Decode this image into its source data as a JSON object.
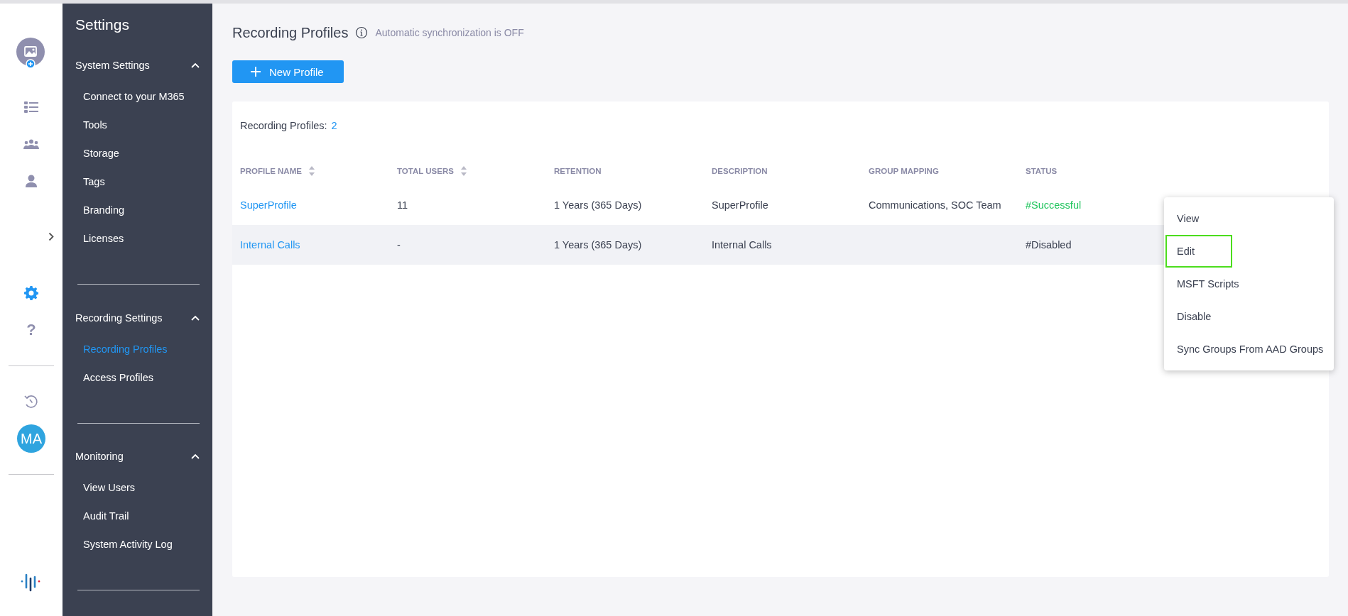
{
  "rail": {
    "top_items": [
      {
        "kind": "list",
        "selected": false
      },
      {
        "kind": "team",
        "selected": false
      },
      {
        "kind": "person",
        "selected": false
      }
    ],
    "mid_items": [
      {
        "kind": "settings",
        "selected": true
      },
      {
        "kind": "help",
        "glyph": "?",
        "selected": false
      }
    ],
    "bottom_items": [
      {
        "kind": "history",
        "selected": false
      }
    ],
    "user_initials": "MA"
  },
  "sidebar": {
    "title": "Settings",
    "sections": [
      {
        "title": "System Settings",
        "expanded": true,
        "items": [
          {
            "label": "Connect to your M365",
            "selected": false
          },
          {
            "label": "Tools",
            "selected": false
          },
          {
            "label": "Storage",
            "selected": false
          },
          {
            "label": "Tags",
            "selected": false
          },
          {
            "label": "Branding",
            "selected": false
          },
          {
            "label": "Licenses",
            "selected": false
          }
        ]
      },
      {
        "title": "Recording Settings",
        "expanded": true,
        "items": [
          {
            "label": "Recording Profiles",
            "selected": true
          },
          {
            "label": "Access Profiles",
            "selected": false
          }
        ]
      },
      {
        "title": "Monitoring",
        "expanded": true,
        "items": [
          {
            "label": "View Users",
            "selected": false
          },
          {
            "label": "Audit Trail",
            "selected": false
          },
          {
            "label": "System Activity Log",
            "selected": false
          }
        ]
      }
    ]
  },
  "page": {
    "title": "Recording Profiles",
    "sync_note": "Automatic synchronization is OFF",
    "new_button": "New Profile"
  },
  "table": {
    "count_label": "Recording Profiles:",
    "count": "2",
    "columns": [
      {
        "label": "PROFILE NAME",
        "sortable": true
      },
      {
        "label": "TOTAL USERS",
        "sortable": true
      },
      {
        "label": "RETENTION",
        "sortable": false
      },
      {
        "label": "DESCRIPTION",
        "sortable": false
      },
      {
        "label": "GROUP MAPPING",
        "sortable": false
      },
      {
        "label": "STATUS",
        "sortable": false
      }
    ],
    "rows": [
      {
        "profile_name": "SuperProfile",
        "total_users": "11",
        "retention": "1 Years (365 Days)",
        "description": "SuperProfile",
        "group_mapping": "Communications, SOC Team",
        "status": {
          "text": "#Successful",
          "color": "#22c55e"
        },
        "highlighted": false
      },
      {
        "profile_name": "Internal Calls",
        "total_users": "-",
        "retention": "1 Years (365 Days)",
        "description": "Internal Calls",
        "status": {
          "text": "#Disabled",
          "color": "#3b4151"
        },
        "highlighted": true
      }
    ]
  },
  "action_menu": {
    "items": [
      {
        "label": "View",
        "focused": false
      },
      {
        "label": "Edit",
        "focused": true
      },
      {
        "label": "MSFT Scripts",
        "focused": false
      },
      {
        "label": "Disable",
        "focused": false
      },
      {
        "label": "Sync Groups From AAD Groups",
        "focused": false
      }
    ]
  }
}
